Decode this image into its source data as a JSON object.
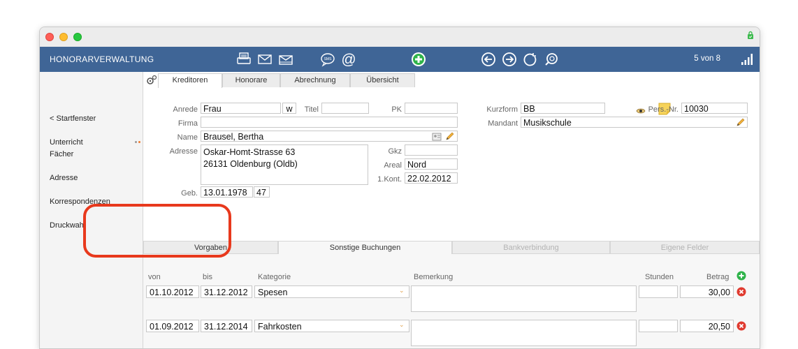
{
  "window": {
    "app_title": "HONORARVERWALTUNG",
    "pager": "5 von 8",
    "colors": {
      "header": "#3f6596",
      "highlight": "#e8391d",
      "add": "#2fb34a",
      "delete": "#e03a2f"
    }
  },
  "toolbar_icons": [
    "printer-icon",
    "envelope-icon",
    "envelope-open-icon",
    "sms-icon",
    "at-icon",
    "add-icon",
    "back-icon",
    "forward-icon",
    "refresh-icon",
    "search-icon"
  ],
  "sidebar": {
    "items": [
      {
        "label": "< Startfenster"
      },
      {
        "label": "Unterricht\nFächer"
      },
      {
        "label": "Adresse"
      },
      {
        "label": "Korrespondenzen"
      },
      {
        "label": "Druckwahl"
      }
    ]
  },
  "tabs": [
    "Kreditoren",
    "Honorare",
    "Abrechnung",
    "Übersicht"
  ],
  "form": {
    "anrede_label": "Anrede",
    "anrede": "Frau",
    "geschlecht": "w",
    "titel_label": "Titel",
    "titel": "",
    "pk_label": "PK",
    "pk": "",
    "firma_label": "Firma",
    "firma": "",
    "name_label": "Name",
    "name": "Brausel, Bertha",
    "adresse_label": "Adresse",
    "adresse_line1": "Oskar-Homt-Strasse 63",
    "adresse_line2": "26131 Oldenburg (Oldb)",
    "gkz_label": "Gkz",
    "gkz": "",
    "areal_label": "Areal",
    "areal": "Nord",
    "kont_label": "1.Kont.",
    "kont": "22.02.2012",
    "geb_label": "Geb.",
    "geb": "13.01.1978",
    "alter": "47",
    "kurzform_label": "Kurzform",
    "kurzform": "BB",
    "persnr_label": "Pers.-Nr.",
    "persnr": "10030",
    "mandant_label": "Mandant",
    "mandant": "Musikschule"
  },
  "subtabs": [
    "Vorgaben",
    "Sonstige Buchungen",
    "Bankverbindung",
    "Eigene Felder"
  ],
  "bookings": {
    "headers": {
      "von": "von",
      "bis": "bis",
      "kategorie": "Kategorie",
      "bemerkung": "Bemerkung",
      "stunden": "Stunden",
      "betrag": "Betrag"
    },
    "rows": [
      {
        "von": "01.10.2012",
        "bis": "31.12.2012",
        "kategorie": "Spesen",
        "bemerkung": "",
        "stunden": "",
        "betrag": "30,00"
      },
      {
        "von": "01.09.2012",
        "bis": "31.12.2014",
        "kategorie": "Fahrkosten",
        "bemerkung": "",
        "stunden": "",
        "betrag": "20,50"
      }
    ]
  }
}
